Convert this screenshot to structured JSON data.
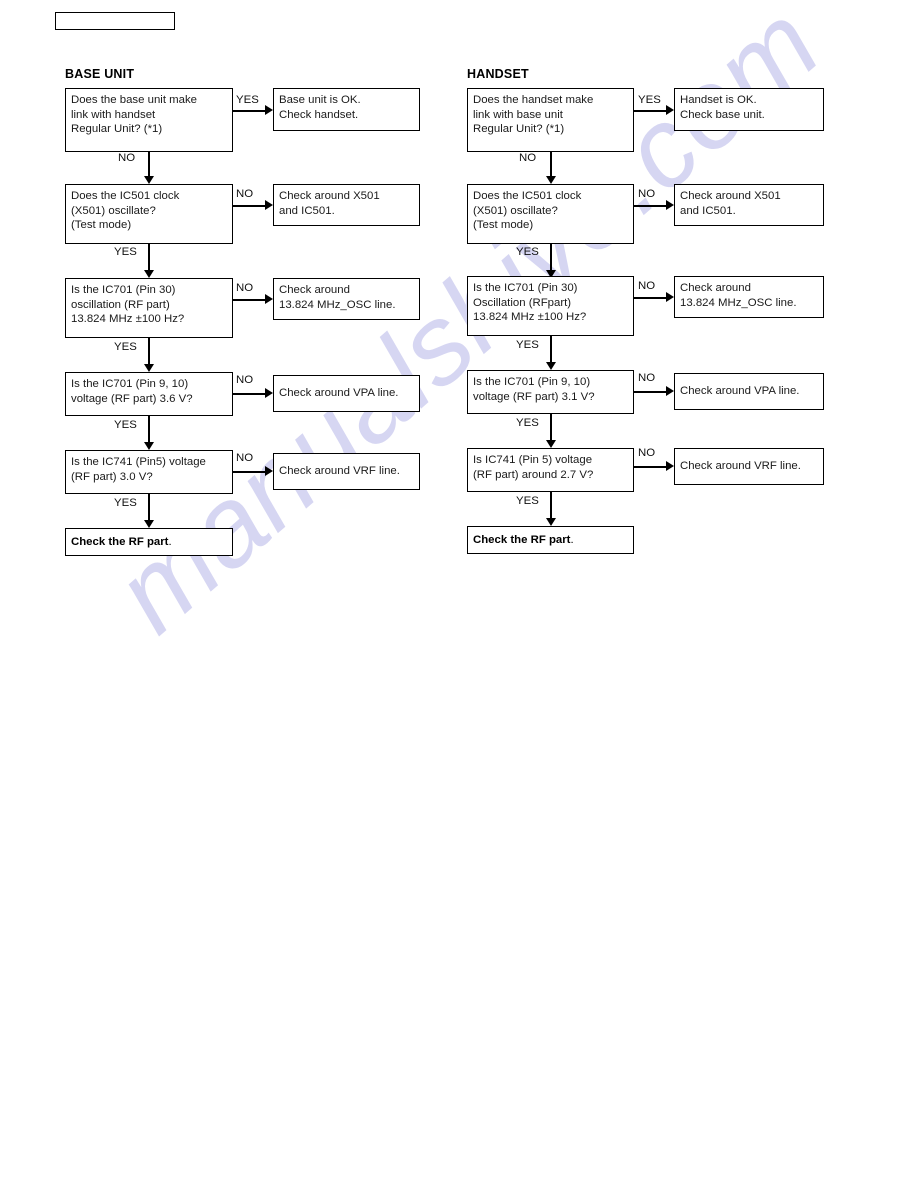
{
  "page": {
    "watermark": "manualshive.com",
    "header_box_text": ""
  },
  "sections": [
    {
      "id": "base",
      "title": "BASE UNIT"
    },
    {
      "id": "handset",
      "title": "HANDSET"
    }
  ],
  "base_unit": {
    "title": "BASE UNIT",
    "nodes": [
      {
        "name": "link-question",
        "lines": [
          "Does the base unit make",
          "link with handset",
          "Regular Unit? (*1)"
        ]
      },
      {
        "name": "link-ok-result",
        "lines": [
          "Base unit is OK.",
          "Check handset."
        ]
      },
      {
        "name": "ic501-clock-question",
        "lines": [
          "Does the IC501 clock",
          "(X501) oscillate?",
          "(Test mode)"
        ]
      },
      {
        "name": "check-x501-ic501",
        "lines": [
          "Check around X501",
          "and IC501."
        ]
      },
      {
        "name": "ic701-pin30-question",
        "lines": [
          "Is the IC701 (Pin 30)",
          "oscillation (RF part)",
          "13.824 MHz ±100 Hz?"
        ]
      },
      {
        "name": "check-osc-line",
        "lines": [
          "Check around",
          "13.824 MHz_OSC line."
        ]
      },
      {
        "name": "ic701-pin910-question",
        "lines": [
          "Is the IC701 (Pin 9, 10)",
          "voltage (RF part) 3.6 V?"
        ]
      },
      {
        "name": "check-vpa-line",
        "lines": [
          "Check around VPA line."
        ]
      },
      {
        "name": "ic741-pin5-question",
        "lines": [
          "Is the IC741 (Pin5) voltage",
          "(RF part) 3.0 V?"
        ]
      },
      {
        "name": "check-vrf-line",
        "lines": [
          "Check around VRF line."
        ]
      },
      {
        "name": "final-result",
        "lines": [
          "Check the RF part",
          "."
        ]
      }
    ],
    "edge_labels": {
      "yes1": "YES",
      "no1": "NO",
      "no2": "NO",
      "yes2": "YES",
      "no3": "NO",
      "yes3": "YES",
      "no4": "NO",
      "yes4": "YES",
      "no5": "NO",
      "yes5": "YES"
    }
  },
  "handset": {
    "title": "HANDSET",
    "nodes": [
      {
        "name": "link-question",
        "lines": [
          "Does the handset make",
          "link with base unit",
          "Regular Unit? (*1)"
        ]
      },
      {
        "name": "link-ok-result",
        "lines": [
          "Handset is OK.",
          "Check base unit."
        ]
      },
      {
        "name": "ic501-clock-question",
        "lines": [
          "Does the IC501 clock",
          "(X501) oscillate?",
          "(Test mode)"
        ]
      },
      {
        "name": "check-x501-ic501",
        "lines": [
          "Check around X501",
          "and IC501."
        ]
      },
      {
        "name": "ic701-pin30-question",
        "lines": [
          "Is the IC701 (Pin 30)",
          "Oscillation (RFpart)",
          "13.824 MHz ±100 Hz?"
        ]
      },
      {
        "name": "check-osc-line",
        "lines": [
          "Check around",
          "13.824 MHz_OSC line."
        ]
      },
      {
        "name": "ic701-pin910-question",
        "lines": [
          "Is the IC701 (Pin 9, 10)",
          "voltage (RF part) 3.1 V?"
        ]
      },
      {
        "name": "check-vpa-line",
        "lines": [
          "Check around VPA line."
        ]
      },
      {
        "name": "ic741-pin5-question",
        "lines": [
          "Is IC741 (Pin 5) voltage",
          "(RF part) around 2.7 V?"
        ]
      },
      {
        "name": "check-vrf-line",
        "lines": [
          "Check around VRF line."
        ]
      },
      {
        "name": "final-result",
        "lines": [
          "Check the RF part",
          "."
        ]
      }
    ],
    "edge_labels": {
      "yes1": "YES",
      "no1": "NO",
      "no2": "NO",
      "yes2": "YES",
      "no3": "NO",
      "yes3": "YES",
      "no4": "NO",
      "yes4": "YES",
      "no5": "NO",
      "yes5": "YES"
    }
  },
  "colors": {
    "line": "#000000",
    "box_border": "#000000",
    "text": "#1a1a1a",
    "watermark": "#c9c9ee",
    "background": "#ffffff"
  }
}
